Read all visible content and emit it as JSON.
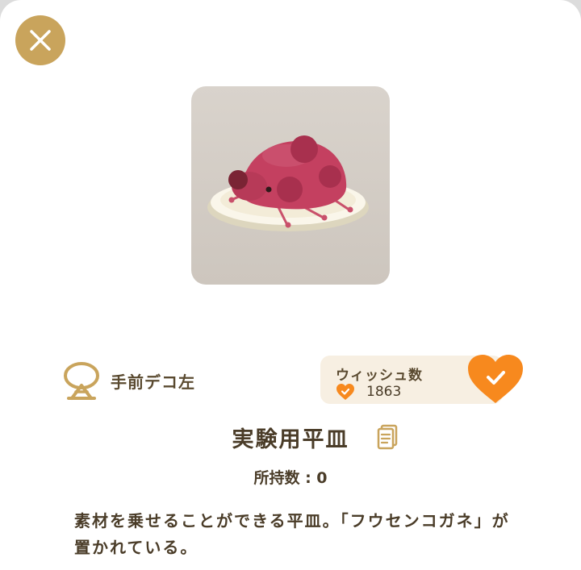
{
  "category": {
    "label": "手前デコ左",
    "icon": "deco-stand-icon"
  },
  "wish": {
    "title": "ウィッシュ数",
    "count": "1863",
    "icon": "heart-check-icon"
  },
  "item": {
    "name": "実験用平皿",
    "owned": "所持数 : 0",
    "description": "素材を乗せることができる平皿。「フウセンコガネ」が置かれている。"
  },
  "colors": {
    "gold": "#c9a45c",
    "orange": "#f7891e",
    "text": "#4a3c28",
    "panel": "#f7efe2"
  }
}
